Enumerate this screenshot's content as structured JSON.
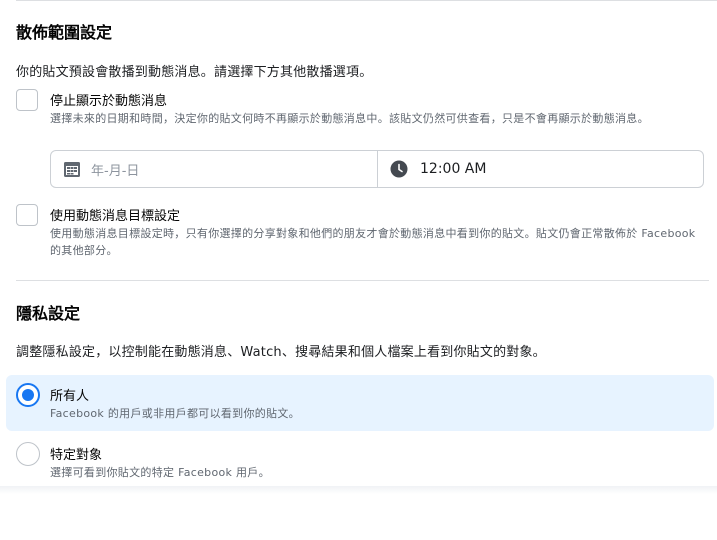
{
  "distribution": {
    "title": "散佈範圍設定",
    "description": "你的貼文預設會散播到動態消息。請選擇下方其他散播選項。",
    "stop_feed": {
      "label": "停止顯示於動態消息",
      "sub": "選擇未來的日期和時間，決定你的貼文何時不再顯示於動態消息中。該貼文仍然可供查看，只是不會再顯示於動態消息。"
    },
    "date_placeholder": "年-月-日",
    "date_icon": "calendar-icon",
    "time_value": "12:00 AM",
    "time_icon": "clock-icon",
    "targeting": {
      "label": "使用動態消息目標設定",
      "sub": "使用動態消息目標設定時，只有你選擇的分享對象和他們的朋友才會於動態消息中看到你的貼文。貼文仍會正常散佈於 Facebook 的其他部分。"
    }
  },
  "privacy": {
    "title": "隱私設定",
    "description": "調整隱私設定，以控制能在動態消息、Watch、搜尋結果和個人檔案上看到你貼文的對象。",
    "options": [
      {
        "label": "所有人",
        "sub": "Facebook 的用戶或非用戶都可以看到你的貼文。",
        "selected": true
      },
      {
        "label": "特定對象",
        "sub": "選擇可看到你貼文的特定 Facebook 用戶。",
        "selected": false
      }
    ]
  },
  "colors": {
    "accent": "#1877f2",
    "selected_bg": "#e7f3ff",
    "secondary_text": "#606770"
  }
}
